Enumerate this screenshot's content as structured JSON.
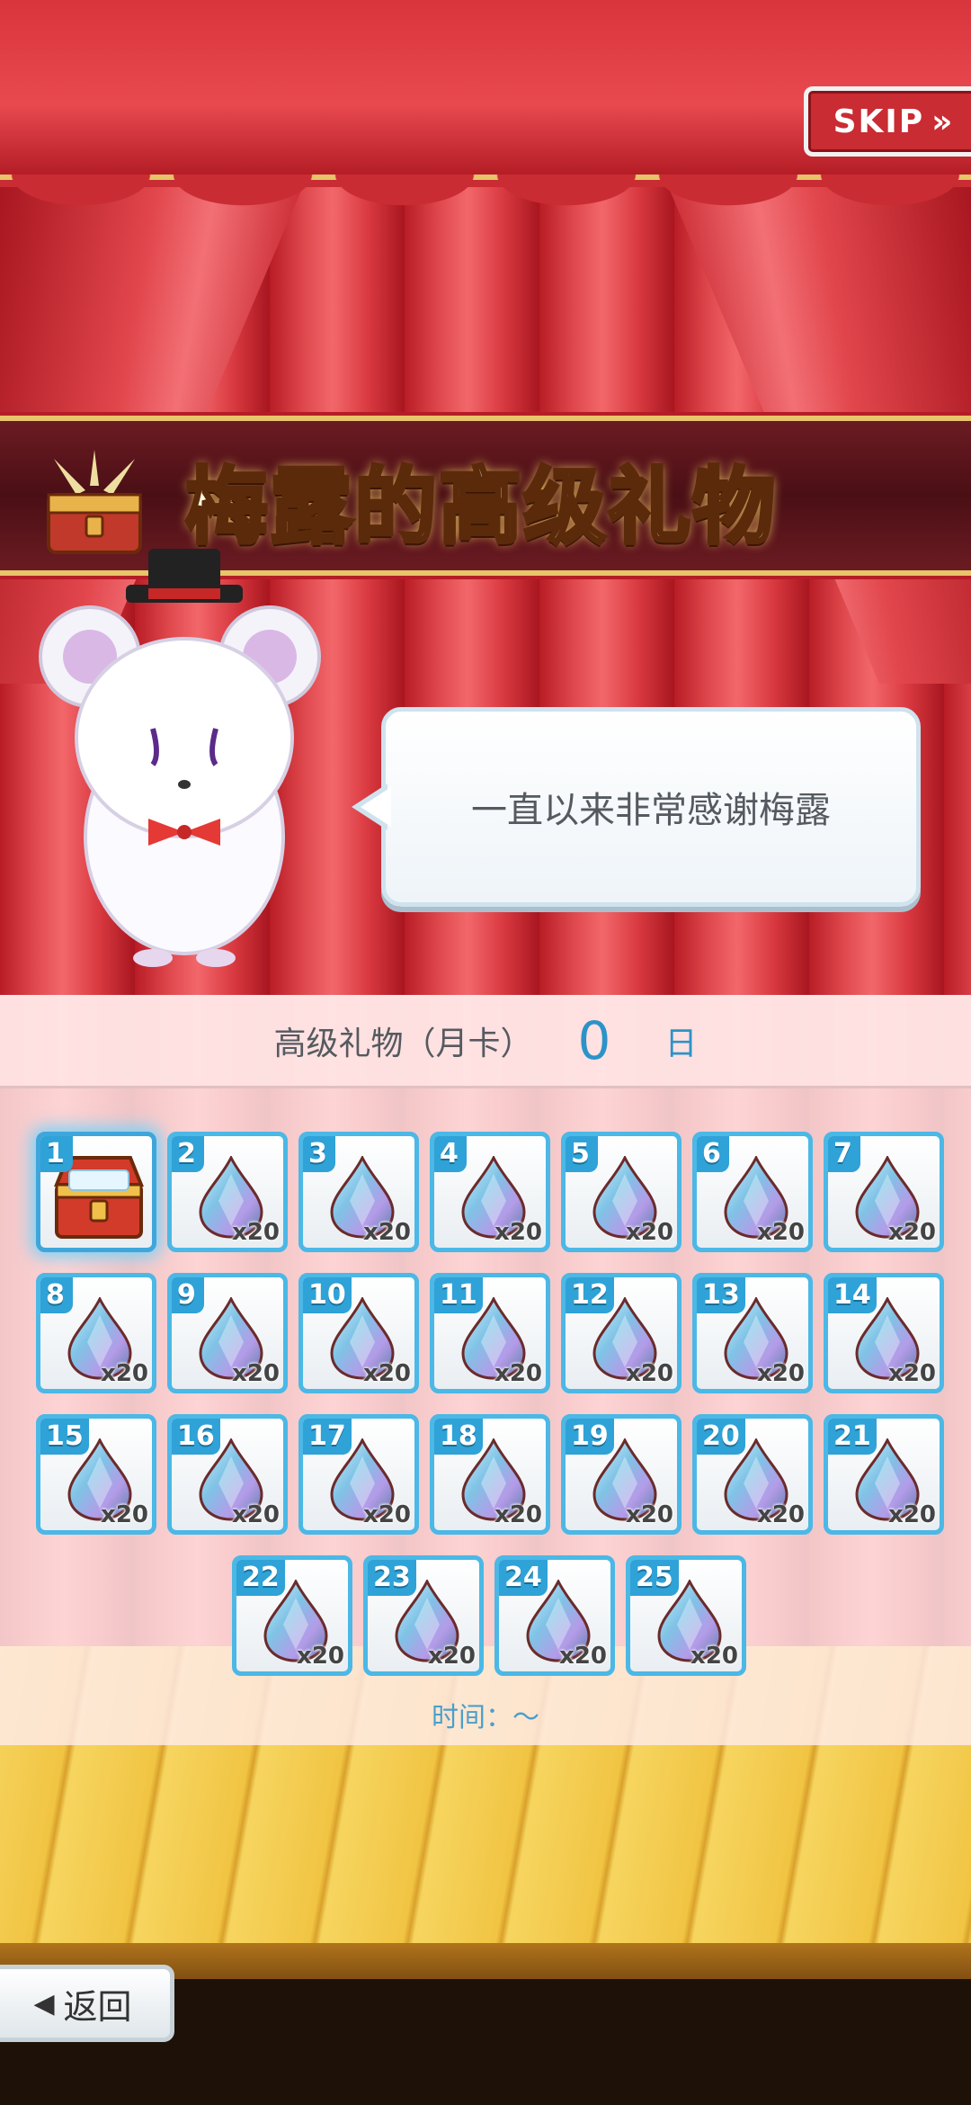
{
  "skip": {
    "label": "SKIP",
    "arrows": "»"
  },
  "title": "梅露的高级礼物",
  "speech": "一直以来非常感谢梅露",
  "panel": {
    "label": "高级礼物（月卡）",
    "days": "0",
    "unit": "日"
  },
  "items": [
    {
      "num": "1",
      "type": "chest",
      "qty": ""
    },
    {
      "num": "2",
      "type": "gem",
      "qty": "x20"
    },
    {
      "num": "3",
      "type": "gem",
      "qty": "x20"
    },
    {
      "num": "4",
      "type": "gem",
      "qty": "x20"
    },
    {
      "num": "5",
      "type": "gem",
      "qty": "x20"
    },
    {
      "num": "6",
      "type": "gem",
      "qty": "x20"
    },
    {
      "num": "7",
      "type": "gem",
      "qty": "x20"
    },
    {
      "num": "8",
      "type": "gem",
      "qty": "x20"
    },
    {
      "num": "9",
      "type": "gem",
      "qty": "x20"
    },
    {
      "num": "10",
      "type": "gem",
      "qty": "x20"
    },
    {
      "num": "11",
      "type": "gem",
      "qty": "x20"
    },
    {
      "num": "12",
      "type": "gem",
      "qty": "x20"
    },
    {
      "num": "13",
      "type": "gem",
      "qty": "x20"
    },
    {
      "num": "14",
      "type": "gem",
      "qty": "x20"
    },
    {
      "num": "15",
      "type": "gem",
      "qty": "x20"
    },
    {
      "num": "16",
      "type": "gem",
      "qty": "x20"
    },
    {
      "num": "17",
      "type": "gem",
      "qty": "x20"
    },
    {
      "num": "18",
      "type": "gem",
      "qty": "x20"
    },
    {
      "num": "19",
      "type": "gem",
      "qty": "x20"
    },
    {
      "num": "20",
      "type": "gem",
      "qty": "x20"
    },
    {
      "num": "21",
      "type": "gem",
      "qty": "x20"
    },
    {
      "num": "22",
      "type": "gem",
      "qty": "x20"
    },
    {
      "num": "23",
      "type": "gem",
      "qty": "x20"
    },
    {
      "num": "24",
      "type": "gem",
      "qty": "x20"
    },
    {
      "num": "25",
      "type": "gem",
      "qty": "x20"
    }
  ],
  "time_label": "时间：～",
  "back": {
    "label": "返回"
  },
  "colors": {
    "accent": "#2fa2d8",
    "curtain": "#d9353c",
    "gold": "#e8c46b"
  }
}
